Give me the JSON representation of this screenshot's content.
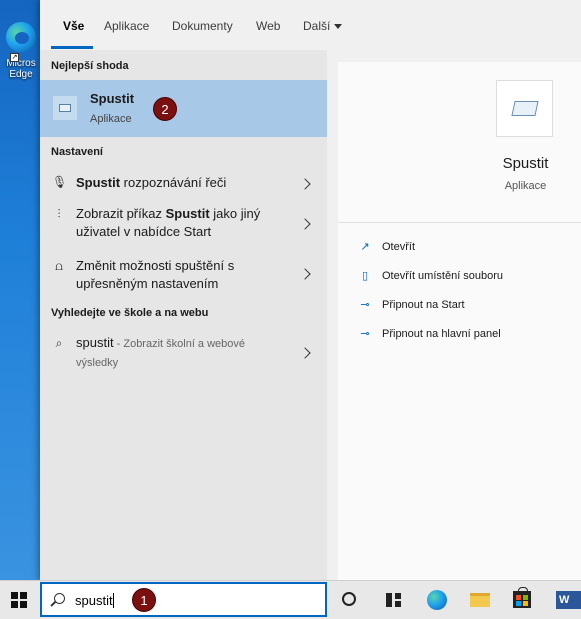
{
  "desktop": {
    "icon_label": "Micros Edge"
  },
  "tabs": {
    "items": [
      "Vše",
      "Aplikace",
      "Dokumenty",
      "Web"
    ],
    "more": "Další"
  },
  "best_match": {
    "heading": "Nejlepší shoda",
    "title": "Spustit",
    "subtitle": "Aplikace",
    "badge": "2"
  },
  "settings": {
    "heading": "Nastavení",
    "items": [
      {
        "bold": "Spustit",
        "text": " rozpoznávání řeči"
      },
      {
        "pre": "Zobrazit příkaz ",
        "bold": "Spustit",
        "text": " jako jiný uživatel v nabídce Start"
      },
      {
        "text": "Změnit možnosti spuštění s upřesněným nastavením"
      }
    ]
  },
  "web": {
    "heading": "Vyhledejte ve škole a na webu",
    "query": "spustit",
    "hint": " - Zobrazit školní a webové výsledky"
  },
  "detail": {
    "app_name": "Spustit",
    "app_type": "Aplikace",
    "actions": [
      "Otevřít",
      "Otevřít umístění souboru",
      "Připnout na Start",
      "Připnout na hlavní panel"
    ]
  },
  "taskbar": {
    "search_value": "spustit",
    "badge": "1",
    "word_letter": "W"
  },
  "colors": {
    "accent": "#0067c0",
    "selected": "#a8c8e8",
    "badge": "#7a1010"
  }
}
